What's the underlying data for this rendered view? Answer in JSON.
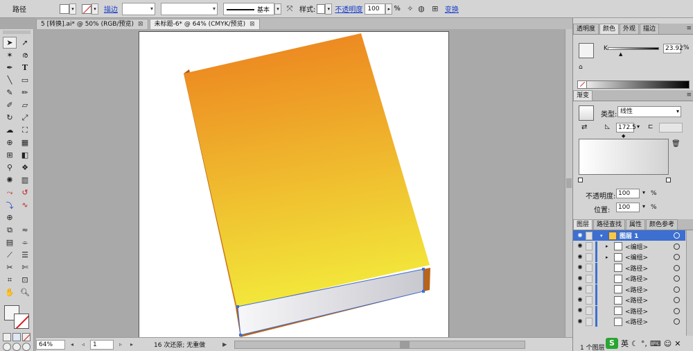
{
  "control_bar": {
    "object_label": "路径",
    "stroke_link": "描边",
    "stroke_profile": "基本",
    "style_label": "样式:",
    "opacity_link": "不透明度",
    "opacity_value": "100",
    "opacity_unit": "%",
    "transform_link": "变换"
  },
  "doc_tabs": [
    {
      "label": "5 [转换].ai* @ 50% (RGB/预览)",
      "close": "⊠"
    },
    {
      "label": "未标题-6* @ 64% (CMYK/预览)",
      "close": "⊠"
    }
  ],
  "status_bar": {
    "zoom": "64%",
    "page": "1",
    "history": "16 次还原; 无重做"
  },
  "color_panel": {
    "tabs": [
      "透明度",
      "颜色",
      "外观",
      "描边"
    ],
    "active_tab": 1,
    "channel_label": "K",
    "channel_value": "23.92",
    "unit": "%"
  },
  "gradient_panel": {
    "title": "渐变",
    "type_label": "类型:",
    "type_value": "线性",
    "angle": "172.5",
    "opacity_label": "不透明度:",
    "opacity_value": "100",
    "location_label": "位置:",
    "location_value": "100",
    "unit": "%"
  },
  "layers_panel": {
    "tabs": [
      "图层",
      "路径查找",
      "属性",
      "颜色参考"
    ],
    "active_tab": 0,
    "rows": [
      {
        "name": "图层 1",
        "level": 0,
        "selected": true
      },
      {
        "name": "<编组>",
        "level": 1,
        "selected": false
      },
      {
        "name": "<编组>",
        "level": 1,
        "selected": false
      },
      {
        "name": "<路径>",
        "level": 1,
        "selected": false
      },
      {
        "name": "<路径>",
        "level": 1,
        "selected": false
      },
      {
        "name": "<路径>",
        "level": 1,
        "selected": false
      },
      {
        "name": "<路径>",
        "level": 1,
        "selected": false
      },
      {
        "name": "<路径>",
        "level": 1,
        "selected": false
      },
      {
        "name": "<路径>",
        "level": 1,
        "selected": false
      }
    ],
    "footer": "1 个图层"
  },
  "tray": {
    "ime": "英"
  },
  "colors": {
    "book_top": "#ec7f1e",
    "book_bottom": "#f2e63a",
    "spine": "#c76d16",
    "pages": "#d6d6dc",
    "selection": "#3d6fd0",
    "link": "#1a3ec9"
  }
}
